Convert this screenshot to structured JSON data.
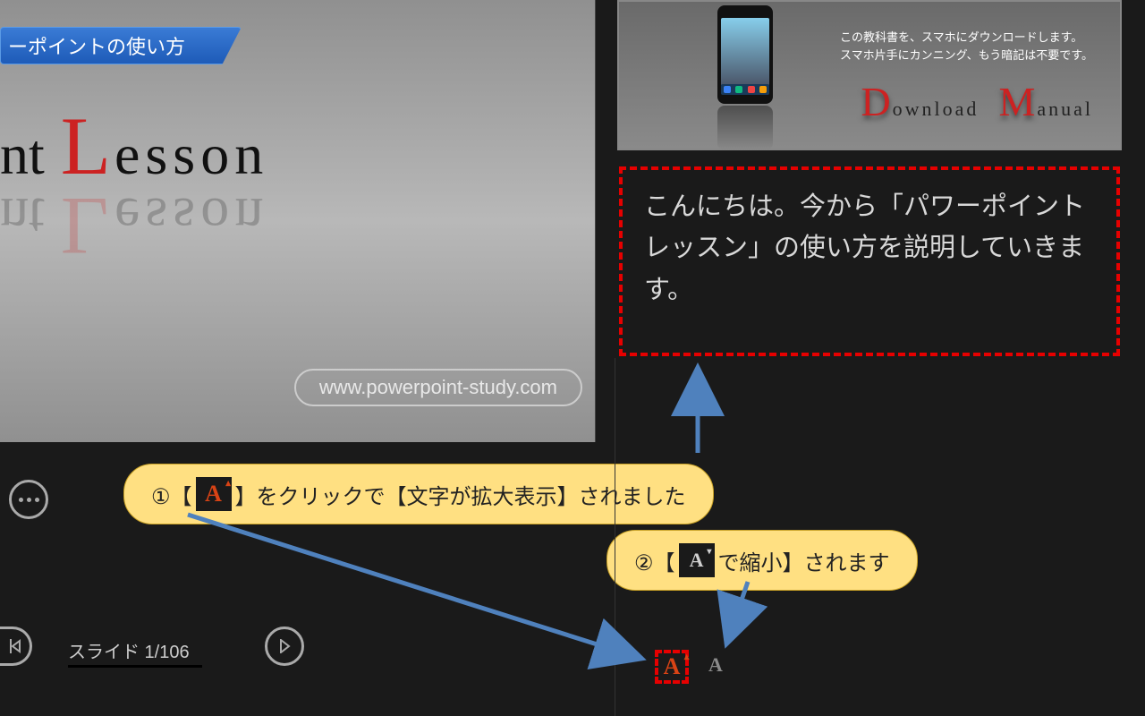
{
  "slide": {
    "title_tab": "ーポイントの使い方",
    "lesson_nt": "nt",
    "lesson_L": "L",
    "lesson_tail": "esson",
    "url": "www.powerpoint-study.com"
  },
  "right_top": {
    "small_line1": "この教科書を、スマホにダウンロードします。",
    "small_line2": "スマホ片手にカンニング、もう暗記は不要です。",
    "D": "D",
    "ownload": "ownload",
    "M": "M",
    "anual": "anual"
  },
  "notes": {
    "text": "こんにちは。今から「パワーポイントレッスン」の使い方を説明していきます。"
  },
  "callouts": {
    "c1_pre": "①【",
    "c1_post": "】をクリックで【文字が拡大表示】されました",
    "c2_pre": "②【",
    "c2_post": "で縮小】されます"
  },
  "footer": {
    "slide_counter": "スライド 1/106"
  },
  "icons": {
    "more": "more-icon",
    "prev": "prev-icon",
    "play": "play-icon",
    "font_increase": "font-increase-icon",
    "font_decrease": "font-decrease-icon"
  }
}
